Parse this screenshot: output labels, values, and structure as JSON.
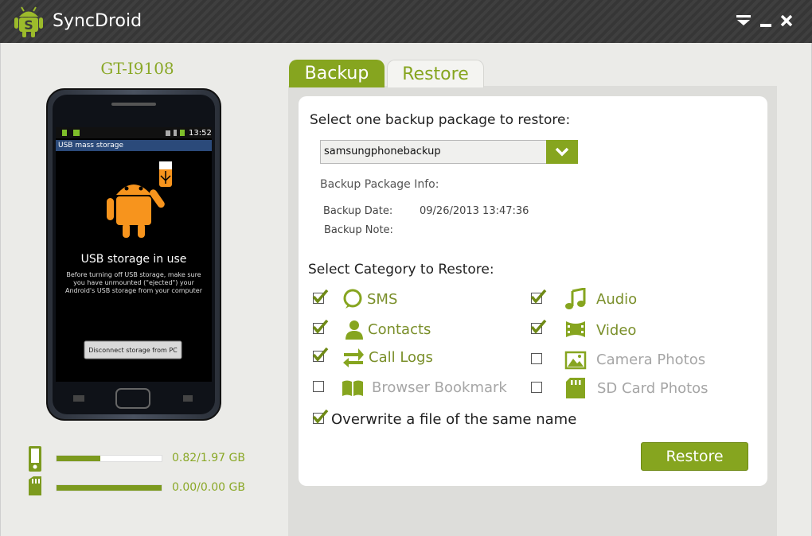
{
  "app": {
    "title": "SyncDroid"
  },
  "window_controls": {
    "menu": "▼",
    "minimize": "–",
    "close": "✕"
  },
  "device": {
    "name": "GT-I9108",
    "screen": {
      "status_time": "13:52",
      "notification_title": "USB mass storage",
      "heading": "USB storage in use",
      "message_line1": "Before turning off USB storage, make sure",
      "message_line2": "you have unmounted (\"ejected\") your",
      "message_line3": "Android's USB storage from your computer",
      "button_label": "Disconnect storage from PC"
    }
  },
  "storage": [
    {
      "name": "phone-storage",
      "text": "0.82/1.97 GB",
      "used_fraction": 0.4162
    },
    {
      "name": "sd-card-storage",
      "text": "0.00/0.00 GB",
      "used_fraction": 1.0
    }
  ],
  "tabs": {
    "backup": "Backup",
    "restore": "Restore"
  },
  "restore": {
    "select_prompt": "Select one backup package to restore:",
    "selected_package": "samsungphonebackup",
    "info_heading": "Backup Package Info:",
    "backup_date_label": "Backup Date:",
    "backup_date_value": "09/26/2013 13:47:36",
    "backup_note_label": "Backup Note:",
    "category_prompt": "Select Category to Restore:",
    "categories": {
      "sms": {
        "label": "SMS",
        "checked": true
      },
      "contacts": {
        "label": "Contacts",
        "checked": true
      },
      "call_logs": {
        "label": "Call Logs",
        "checked": true
      },
      "browser_bookmark": {
        "label": "Browser Bookmark",
        "checked": false
      },
      "audio": {
        "label": "Audio",
        "checked": true
      },
      "video": {
        "label": "Video",
        "checked": true
      },
      "camera_photos": {
        "label": "Camera Photos",
        "checked": false
      },
      "sd_card_photos": {
        "label": "SD Card Photos",
        "checked": false
      }
    },
    "overwrite_label": "Overwrite a file of the same name",
    "overwrite_checked": true,
    "restore_button": "Restore"
  },
  "colors": {
    "accent": "#86a51f",
    "accent_text": "#8aa827",
    "disabled": "#a6a6a6",
    "titlebar": "#3b3b3b"
  }
}
